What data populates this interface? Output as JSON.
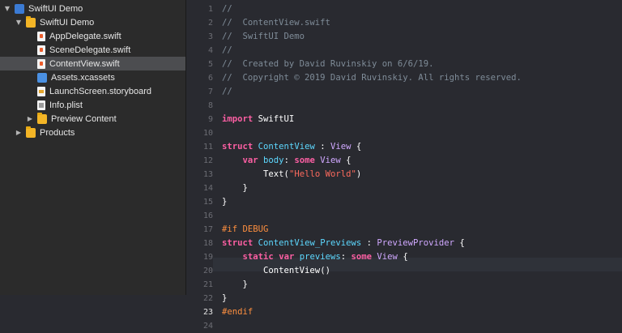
{
  "navigator": {
    "items": [
      {
        "label": "SwiftUI Demo",
        "icon": "project-icon",
        "disclosure": "expanded",
        "depth": 0,
        "kind": "project"
      },
      {
        "label": "SwiftUI Demo",
        "icon": "folder-icon",
        "disclosure": "expanded",
        "depth": 1,
        "kind": "folder"
      },
      {
        "label": "AppDelegate.swift",
        "icon": "swift-file-icon",
        "disclosure": "none",
        "depth": 2,
        "kind": "swift"
      },
      {
        "label": "SceneDelegate.swift",
        "icon": "swift-file-icon",
        "disclosure": "none",
        "depth": 2,
        "kind": "swift"
      },
      {
        "label": "ContentView.swift",
        "icon": "swift-file-icon",
        "disclosure": "none",
        "depth": 2,
        "kind": "swift",
        "selected": true
      },
      {
        "label": "Assets.xcassets",
        "icon": "assets-icon",
        "disclosure": "none",
        "depth": 2,
        "kind": "assets"
      },
      {
        "label": "LaunchScreen.storyboard",
        "icon": "storyboard-icon",
        "disclosure": "none",
        "depth": 2,
        "kind": "storyboard"
      },
      {
        "label": "Info.plist",
        "icon": "plist-icon",
        "disclosure": "none",
        "depth": 2,
        "kind": "plist"
      },
      {
        "label": "Preview Content",
        "icon": "folder-icon",
        "disclosure": "collapsed",
        "depth": 2,
        "kind": "folder"
      },
      {
        "label": "Products",
        "icon": "folder-icon",
        "disclosure": "collapsed",
        "depth": 1,
        "kind": "folder"
      }
    ]
  },
  "editor": {
    "current_line": 23,
    "lines": [
      [
        [
          "//",
          "comment"
        ]
      ],
      [
        [
          "//  ContentView.swift",
          "comment"
        ]
      ],
      [
        [
          "//  SwiftUI Demo",
          "comment"
        ]
      ],
      [
        [
          "//",
          "comment"
        ]
      ],
      [
        [
          "//  Created by David Ruvinskiy on 6/6/19.",
          "comment"
        ]
      ],
      [
        [
          "//  Copyright © 2019 David Ruvinskiy. All rights reserved.",
          "comment"
        ]
      ],
      [
        [
          "//",
          "comment"
        ]
      ],
      [],
      [
        [
          "import",
          "kw"
        ],
        [
          " SwiftUI",
          "plain"
        ]
      ],
      [],
      [
        [
          "struct",
          "kw"
        ],
        [
          " ",
          "plain"
        ],
        [
          "ContentView",
          "type"
        ],
        [
          " : ",
          "plain"
        ],
        [
          "View",
          "type2"
        ],
        [
          " {",
          "plain"
        ]
      ],
      [
        [
          "    ",
          "plain"
        ],
        [
          "var",
          "kw"
        ],
        [
          " ",
          "plain"
        ],
        [
          "body",
          "type"
        ],
        [
          ": ",
          "plain"
        ],
        [
          "some",
          "kw"
        ],
        [
          " ",
          "plain"
        ],
        [
          "View",
          "type2"
        ],
        [
          " {",
          "plain"
        ]
      ],
      [
        [
          "        ",
          "plain"
        ],
        [
          "Text",
          "plain"
        ],
        [
          "(",
          "plain"
        ],
        [
          "\"Hello World\"",
          "str"
        ],
        [
          ")",
          "plain"
        ]
      ],
      [
        [
          "    }",
          "plain"
        ]
      ],
      [
        [
          "}",
          "plain"
        ]
      ],
      [],
      [
        [
          "#if",
          "pre"
        ],
        [
          " DEBUG",
          "pre"
        ]
      ],
      [
        [
          "struct",
          "kw"
        ],
        [
          " ",
          "plain"
        ],
        [
          "ContentView_Previews",
          "type"
        ],
        [
          " : ",
          "plain"
        ],
        [
          "PreviewProvider",
          "type2"
        ],
        [
          " {",
          "plain"
        ]
      ],
      [
        [
          "    ",
          "plain"
        ],
        [
          "static",
          "kw"
        ],
        [
          " ",
          "plain"
        ],
        [
          "var",
          "kw"
        ],
        [
          " ",
          "plain"
        ],
        [
          "previews",
          "type"
        ],
        [
          ": ",
          "plain"
        ],
        [
          "some",
          "kw"
        ],
        [
          " ",
          "plain"
        ],
        [
          "View",
          "type2"
        ],
        [
          " {",
          "plain"
        ]
      ],
      [
        [
          "        ",
          "plain"
        ],
        [
          "ContentView",
          "plain"
        ],
        [
          "()",
          "plain"
        ]
      ],
      [
        [
          "    }",
          "plain"
        ]
      ],
      [
        [
          "}",
          "plain"
        ]
      ],
      [
        [
          "#endif",
          "pre"
        ]
      ],
      []
    ]
  }
}
